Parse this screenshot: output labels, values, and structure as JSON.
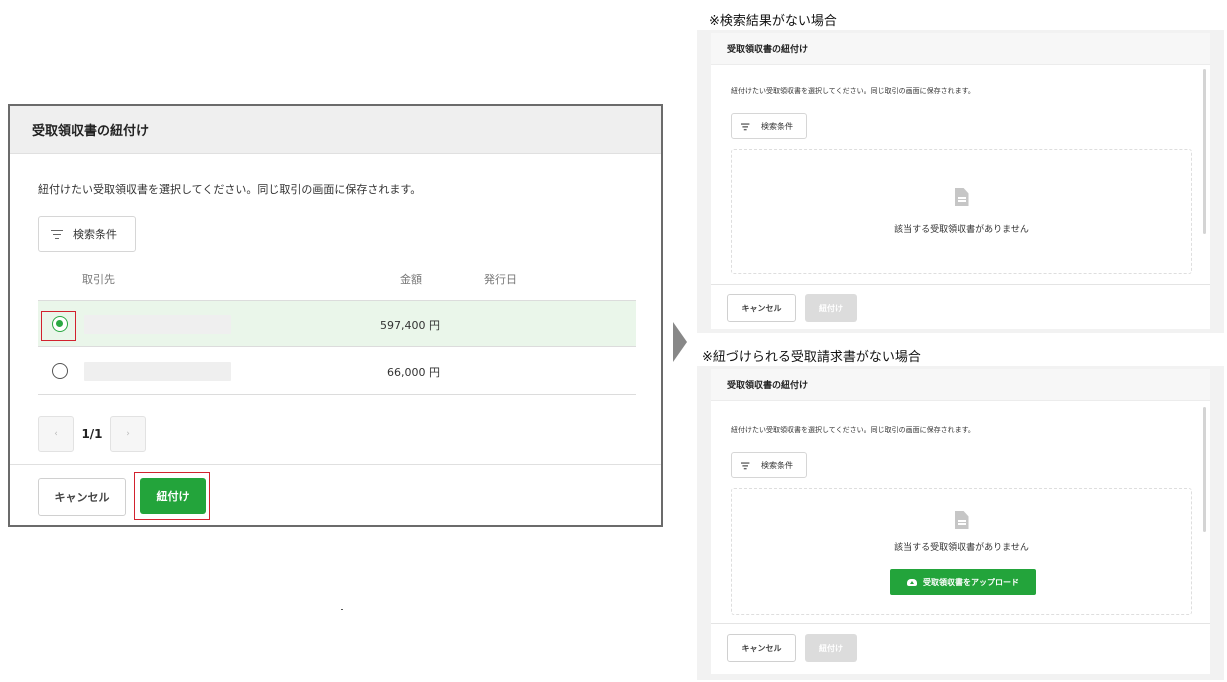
{
  "main_dialog": {
    "title": "受取領収書の紐付け",
    "description": "紐付けたい受取領収書を選択してください。同じ取引の画面に保存されます。",
    "filter_label": "検索条件",
    "columns": [
      "取引先",
      "金額",
      "発行日"
    ],
    "rows": [
      {
        "selected": true,
        "amount": "597,400 円"
      },
      {
        "selected": false,
        "amount": "66,000 円"
      }
    ],
    "pagination": {
      "label": "1/1",
      "prev_icon": "chevron-left-icon",
      "next_icon": "chevron-right-icon"
    },
    "cancel_label": "キャンセル",
    "link_label": "紐付け"
  },
  "panel_no_results": {
    "caption": "※検索結果がない場合",
    "title": "受取領収書の紐付け",
    "description": "紐付けたい受取領収書を選択してください。同じ取引の画面に保存されます。",
    "filter_label": "検索条件",
    "empty_text": "該当する受取領収書がありません",
    "cancel_label": "キャンセル",
    "link_label": "紐付け"
  },
  "panel_no_linked": {
    "caption": "※紐づけられる受取請求書がない場合",
    "title": "受取領収書の紐付け",
    "description": "紐付けたい受取領収書を選択してください。同じ取引の画面に保存されます。",
    "filter_label": "検索条件",
    "empty_text": "該当する受取領収書がありません",
    "upload_label": "受取領収書をアップロード",
    "cancel_label": "キャンセル",
    "link_label": "紐付け"
  },
  "colors": {
    "primary_green": "#23a43b",
    "highlight_red": "#d2222e",
    "selected_row_bg": "#eaf6ea"
  }
}
